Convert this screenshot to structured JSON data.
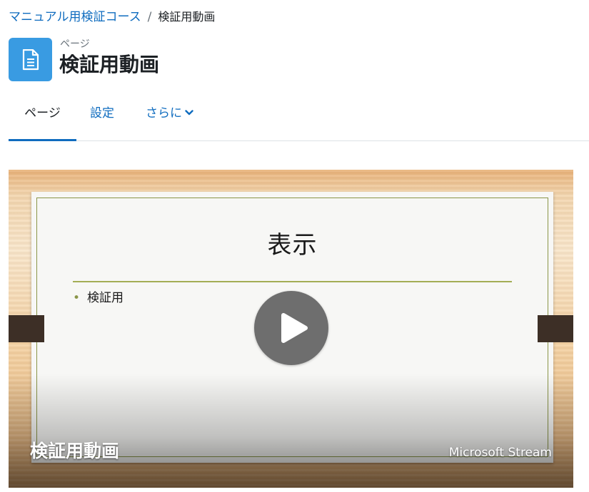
{
  "breadcrumb": {
    "course": "マニュアル用検証コース",
    "separator": "/",
    "current": "検証用動画"
  },
  "header": {
    "icon": "page-document-icon",
    "module_type": "ページ",
    "title": "検証用動画"
  },
  "tabs": [
    {
      "label": "ページ",
      "active": true
    },
    {
      "label": "設定",
      "active": false
    },
    {
      "label": "さらに",
      "active": false,
      "icon": "chevron-down-icon"
    }
  ],
  "video": {
    "slide_title": "表示",
    "slide_bullet": "検証用",
    "overlay_title": "検証用動画",
    "brand": "Microsoft Stream",
    "play_icon": "play-icon"
  },
  "colors": {
    "link": "#0f6cbf",
    "icon_bg": "#399be2",
    "active_tab_underline": "#0f6cbf"
  }
}
